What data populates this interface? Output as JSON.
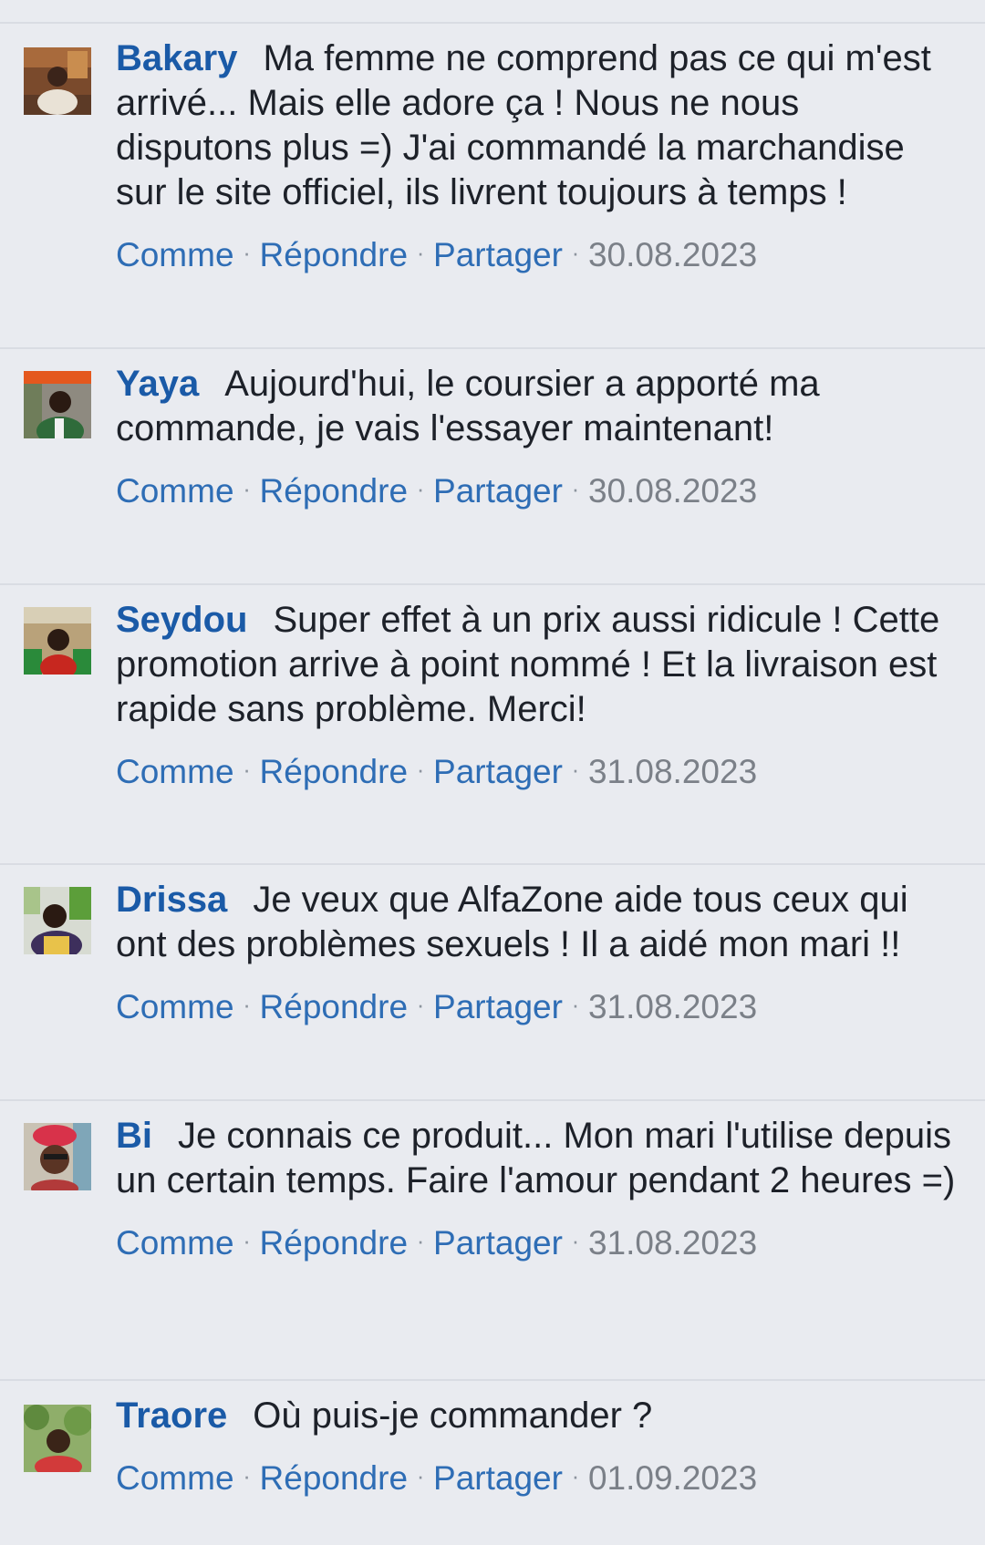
{
  "actions": {
    "like": "Comme",
    "reply": "Répondre",
    "share": "Partager"
  },
  "colors": {
    "background": "#e9ebf0",
    "author": "#1a5aa7",
    "action_link": "#2e6db5",
    "text": "#1d2129",
    "date": "#7b8088"
  },
  "comments": [
    {
      "author": "Bakary",
      "avatar": "avatar-icon",
      "text": "Ma femme ne comprend pas ce qui m'est arrivé... Mais elle adore ça ! Nous ne nous disputons plus =) J'ai commandé la marchandise sur le site officiel, ils livrent toujours à temps !",
      "date": "30.08.2023"
    },
    {
      "author": "Yaya",
      "avatar": "avatar-icon",
      "text": "Aujourd'hui, le coursier a apporté ma commande, je vais l'essayer maintenant!",
      "date": "30.08.2023"
    },
    {
      "author": "Seydou",
      "avatar": "avatar-icon",
      "text": "Super effet à un prix aussi ridicule ! Cette promotion arrive à point nommé ! Et la livraison est rapide sans problème. Merci!",
      "date": "31.08.2023"
    },
    {
      "author": "Drissa",
      "avatar": "avatar-icon",
      "text": "Je veux que AlfaZone aide tous ceux qui ont des problèmes sexuels ! Il a aidé mon mari !!",
      "date": "31.08.2023"
    },
    {
      "author": "Bi",
      "avatar": "avatar-icon",
      "text": "Je connais ce produit... Mon mari l'utilise depuis un certain temps. Faire l'amour pendant 2 heures =)",
      "date": "31.08.2023"
    },
    {
      "author": "Traore",
      "avatar": "avatar-icon",
      "text": "Où puis-je commander ?",
      "date": "01.09.2023"
    }
  ]
}
